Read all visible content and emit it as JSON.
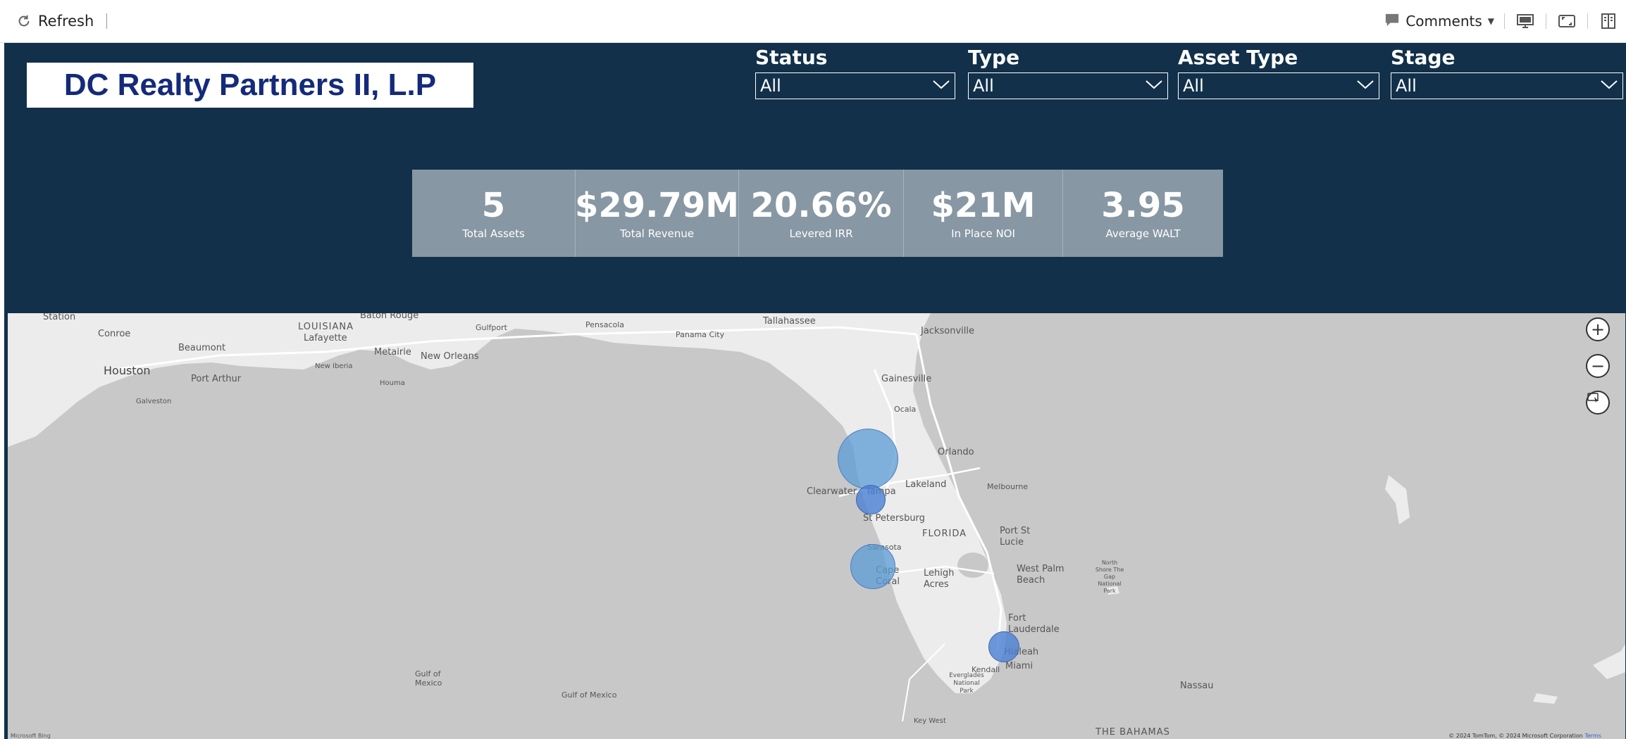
{
  "toolbar": {
    "refresh_label": "Refresh",
    "comments_label": "Comments"
  },
  "report": {
    "title": "DC Realty Partners II, L.P",
    "filters": [
      {
        "label": "Status",
        "value": "All"
      },
      {
        "label": "Type",
        "value": "All"
      },
      {
        "label": "Asset Type",
        "value": "All"
      },
      {
        "label": "Stage",
        "value": "All"
      }
    ],
    "kpis": [
      {
        "value": "5",
        "label": "Total Assets"
      },
      {
        "value": "$29.79M",
        "label": "Total Revenue"
      },
      {
        "value": "20.66%",
        "label": "Levered IRR"
      },
      {
        "value": "$21M",
        "label": "In Place NOI"
      },
      {
        "value": "3.95",
        "label": "Average WALT"
      }
    ]
  },
  "map": {
    "labels": {
      "houston": "Houston",
      "beaumont": "Beaumont",
      "conroe": "Conroe",
      "lafayette": "Lafayette",
      "louisiana": "LOUISIANA",
      "baton_rouge": "Baton Rouge",
      "new_orleans": "New Orleans",
      "metairie": "Metairie",
      "new_iberia": "New Iberia",
      "houma": "Houma",
      "port_arthur": "Port Arthur",
      "galveston": "Galveston",
      "gulfport": "Gulfport",
      "pensacola": "Pensacola",
      "panama_city": "Panama City",
      "tallahassee": "Tallahassee",
      "jacksonville": "Jacksonville",
      "gainesville": "Gainesville",
      "ocala": "Ocala",
      "orlando": "Orlando",
      "lakeland": "Lakeland",
      "clearwater": "Clearwater",
      "tampa": "Tampa",
      "st_petersburg": "St Petersburg",
      "florida": "FLORIDA",
      "melbourne": "Melbourne",
      "port_st_lucie": "Port St Lucie",
      "sarasota": "Sarasota",
      "cape_coral": "Cape Coral",
      "lehigh_acres": "Lehigh Acres",
      "west_palm_beach": "West Palm Beach",
      "fort_lauderdale": "Fort Lauderdale",
      "hialeah": "Hialeah",
      "miami": "Miami",
      "kendall": "Kendall",
      "everglades": "Everglades National Park",
      "key_west": "Key West",
      "gulf_of_mexico_1": "Gulf of Mexico",
      "gulf_of_mexico_2": "Gulf of Mexico",
      "bahamas": "THE BAHAMAS",
      "nassau": "Nassau",
      "north_shore": "North Shore The Gap National Park",
      "station": "Station"
    },
    "copyright": "© 2024 TomTom, © 2024 Microsoft Corporation",
    "terms": "Terms",
    "ms_logo": "Microsoft Bing",
    "bubble_color": "#5b9bd5"
  }
}
